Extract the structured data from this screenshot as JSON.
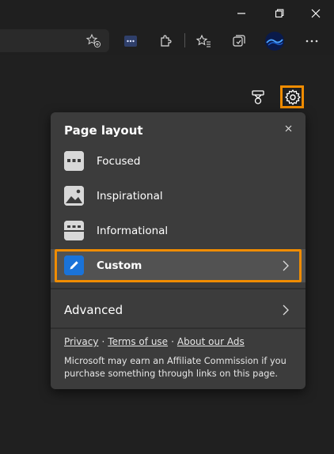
{
  "window_controls": {
    "minimize_icon": "minimize-icon",
    "restore_icon": "restore-icon",
    "close_icon": "close-icon"
  },
  "toolbar": {
    "favorite_add_icon": "star-add-icon",
    "extension_icons": [
      "media-extension-icon",
      "extensions-icon",
      "favorites-icon",
      "collections-icon",
      "profile-icon",
      "more-icon"
    ]
  },
  "newtab": {
    "rewards_icon": "rewards-icon",
    "settings_icon": "gear-icon",
    "highlight_color": "#f08c00"
  },
  "page_layout_panel": {
    "title": "Page layout",
    "options": [
      {
        "label": "Focused",
        "icon": "focused-layout-icon"
      },
      {
        "label": "Inspirational",
        "icon": "inspirational-layout-icon"
      },
      {
        "label": "Informational",
        "icon": "informational-layout-icon"
      },
      {
        "label": "Custom",
        "icon": "custom-pencil-icon",
        "selected": true,
        "accent": "#1a73d9"
      }
    ],
    "advanced_label": "Advanced",
    "links": [
      "Privacy",
      "Terms of use",
      "About our Ads"
    ],
    "link_separator": "·",
    "disclaimer": "Microsoft may earn an Affiliate Commission if you purchase something through links on this page."
  }
}
